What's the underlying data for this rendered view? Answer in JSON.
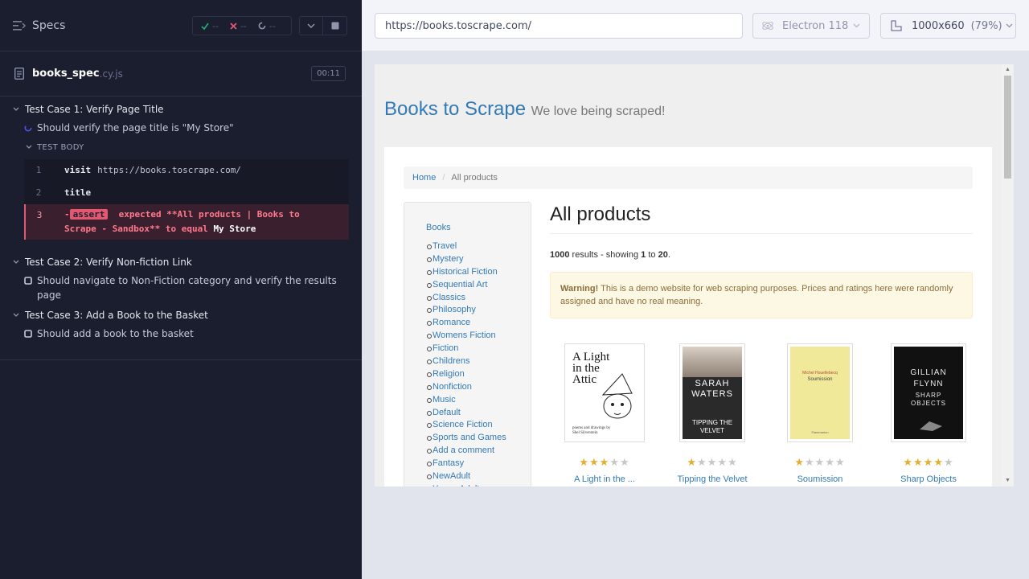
{
  "runner": {
    "header": {
      "title": "Specs",
      "passed": "--",
      "failed": "--",
      "pending": "--"
    },
    "spec_file": {
      "name": "books_spec",
      "ext": ".cy.js",
      "duration": "00:11"
    },
    "suites": [
      {
        "title": "Test Case 1: Verify Page Title",
        "test": "Should verify the page title is \"My Store\""
      },
      {
        "title": "Test Case 2: Verify Non-fiction Link",
        "test": "Should navigate to Non-Fiction category and verify the results page"
      },
      {
        "title": "Test Case 3: Add a Book to the Basket",
        "test": "Should add a book to the basket"
      }
    ],
    "test_body_label": "TEST BODY",
    "commands": [
      {
        "num": "1",
        "name": "visit",
        "arg": "https://books.toscrape.com/"
      },
      {
        "num": "2",
        "name": "title",
        "arg": ""
      },
      {
        "num": "3",
        "prefix": "-",
        "name": "assert",
        "message": "expected **All products | Books to Scrape - Sandbox** to equal",
        "value": "My Store"
      }
    ]
  },
  "toolbar": {
    "url": "https://books.toscrape.com/",
    "browser": "Electron 118",
    "viewport": "1000x660",
    "scale": "(79%)"
  },
  "aut": {
    "brand": "Books to Scrape",
    "tagline": "We love being scraped!",
    "breadcrumb": {
      "home": "Home",
      "current": "All products"
    },
    "category_root": "Books",
    "categories": [
      "Travel",
      "Mystery",
      "Historical Fiction",
      "Sequential Art",
      "Classics",
      "Philosophy",
      "Romance",
      "Womens Fiction",
      "Fiction",
      "Childrens",
      "Religion",
      "Nonfiction",
      "Music",
      "Default",
      "Science Fiction",
      "Sports and Games",
      "Add a comment",
      "Fantasy",
      "NewAdult",
      "Young Adult"
    ],
    "heading": "All products",
    "results": {
      "count": "1000",
      "mid": "results - showing",
      "from": "1",
      "to_word": "to",
      "to": "20",
      "end": "."
    },
    "warning": {
      "strong": "Warning!",
      "text": "This is a demo website for web scraping purposes. Prices and ratings here were randomly assigned and have no real meaning."
    },
    "products": [
      {
        "title": "A Light in the ...",
        "rating": 3,
        "cover_lines": [
          "A Light",
          "in the",
          "Attic"
        ],
        "cover_sub": "poems and drawings by Shel Silverstein"
      },
      {
        "title": "Tipping the Velvet",
        "rating": 1,
        "cover_lines": [
          "SARAH",
          "WATERS"
        ],
        "cover_sub": "TIPPING THE VELVET"
      },
      {
        "title": "Soumission",
        "rating": 1,
        "cover_lines": [
          "Michel Houellebecq",
          "Soumission"
        ],
        "cover_sub": "Flammarion"
      },
      {
        "title": "Sharp Objects",
        "rating": 4,
        "cover_lines": [
          "GILLIAN",
          "FLYNN"
        ],
        "cover_sub": "SHARP OBJECTS"
      }
    ]
  },
  "colors": {
    "runner_bg": "#1b1e2e",
    "fail": "#e45770",
    "link": "#337ab7",
    "star": "#e6ae2d"
  }
}
